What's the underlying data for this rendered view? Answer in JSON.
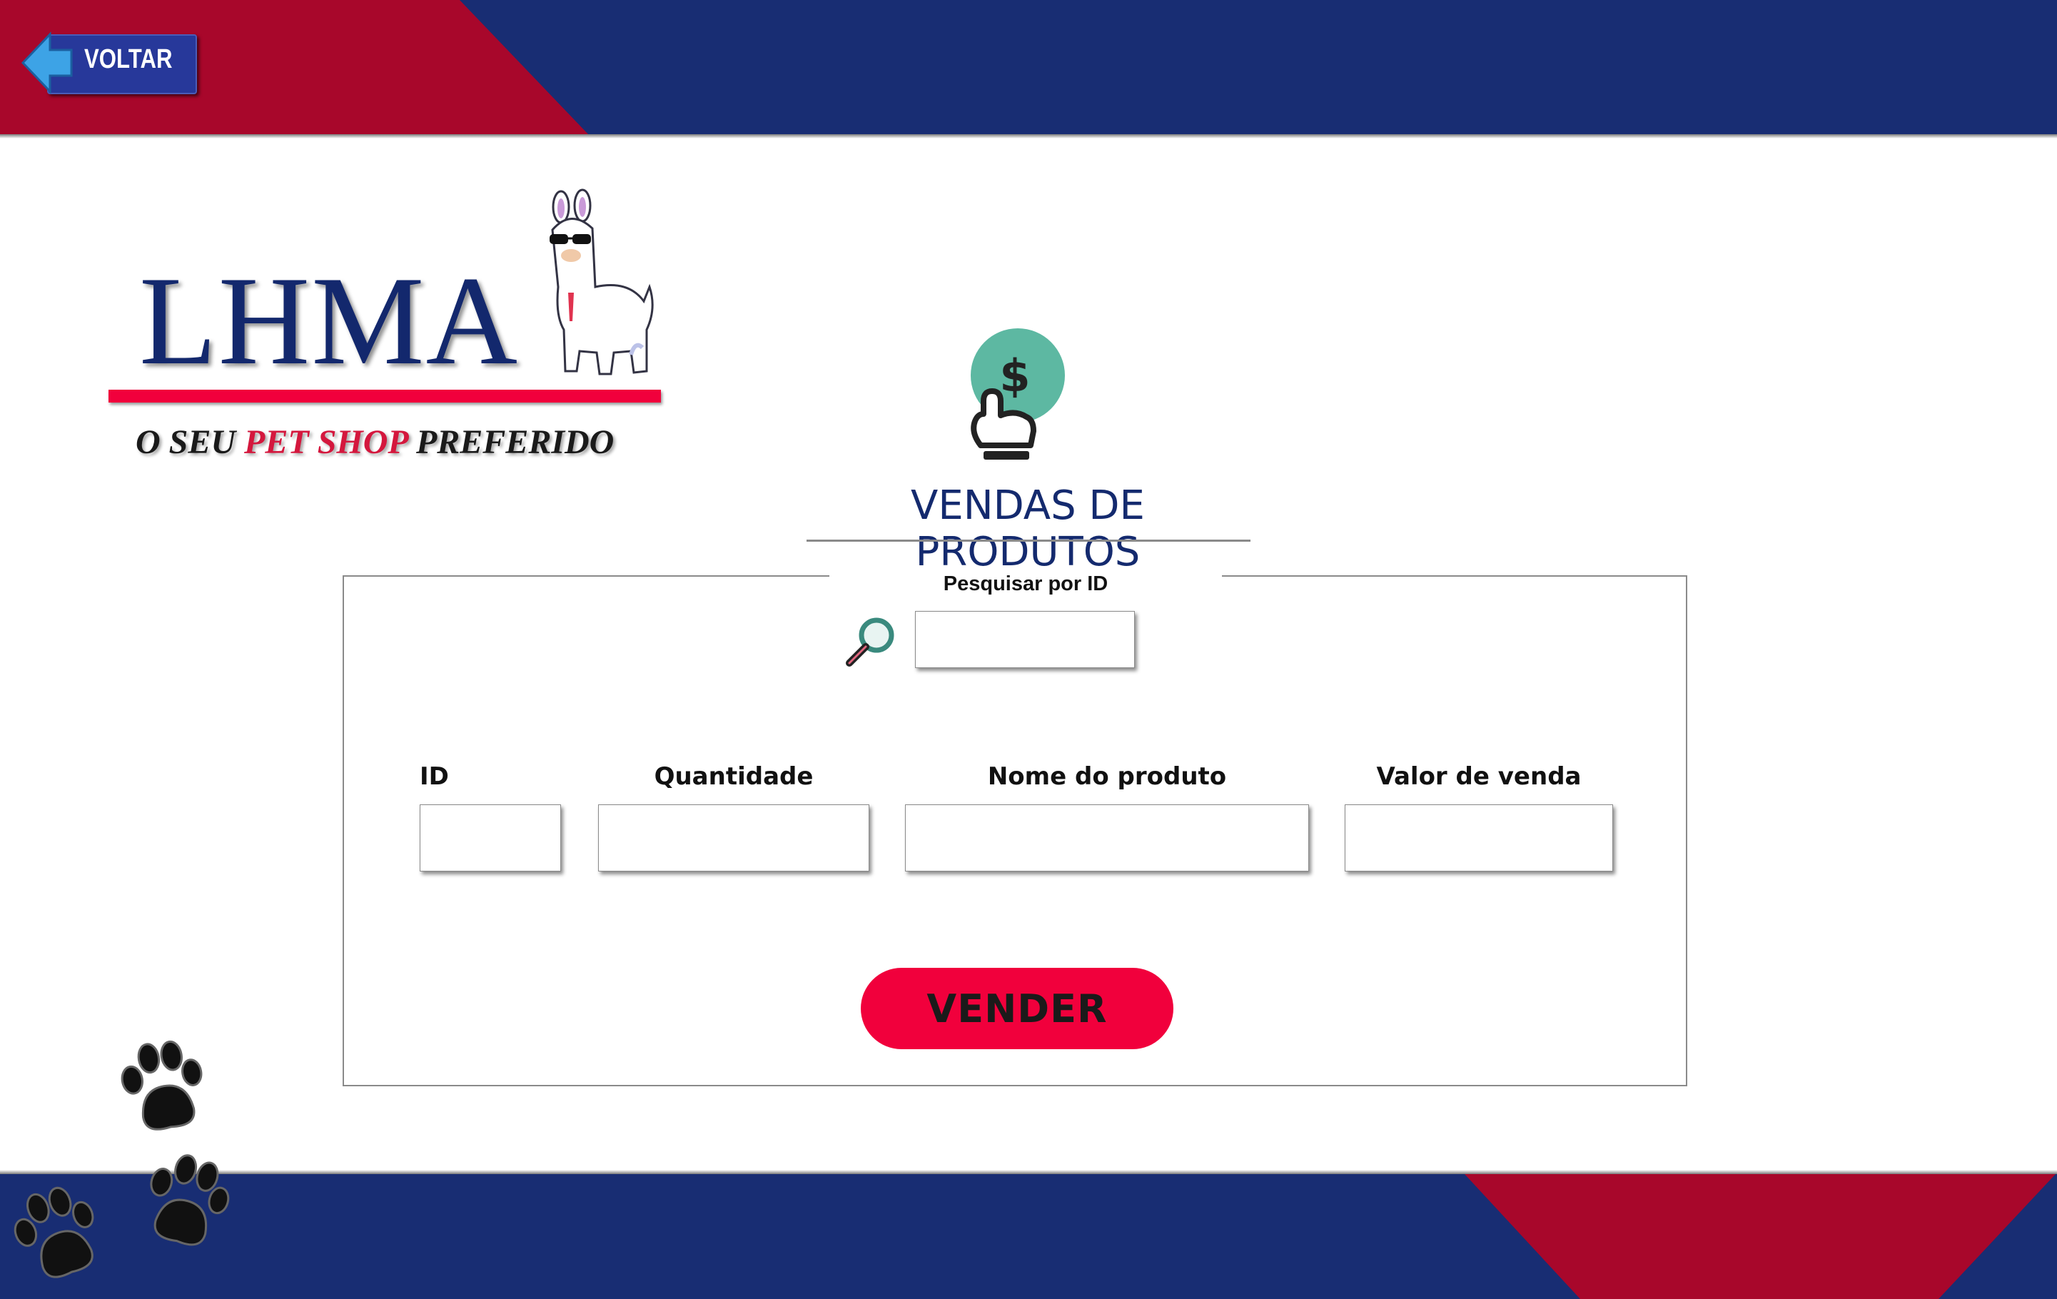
{
  "header": {
    "back_button_label": "VOLTAR"
  },
  "logo": {
    "brand": "LHMA",
    "tagline_part1": "O SEU ",
    "tagline_highlight": "PET SHOP",
    "tagline_part2": " PREFERIDO"
  },
  "main": {
    "title": "VENDAS DE PRODUTOS",
    "search": {
      "label": "Pesquisar por ID",
      "value": ""
    },
    "fields": {
      "id_label": "ID",
      "id_value": "",
      "quantity_label": "Quantidade",
      "quantity_value": "",
      "product_name_label": "Nome do produto",
      "product_name_value": "",
      "sale_value_label": "Valor de venda",
      "sale_value_value": ""
    },
    "sell_button_label": "VENDER"
  },
  "colors": {
    "navy": "#182d73",
    "crimson": "#a8072b",
    "accent_red": "#f1003c",
    "title_blue": "#142a6e",
    "icon_teal": "#5db8a2"
  },
  "icons": {
    "back": "arrow-left-icon",
    "mascot": "llama-icon",
    "sales": "hand-dollar-icon",
    "search": "magnifier-icon",
    "decor": "paw-print-icon"
  }
}
